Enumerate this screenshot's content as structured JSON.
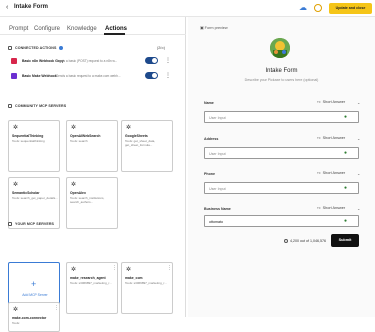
{
  "header": {
    "title": "Intake Form",
    "back_glyph": "‹",
    "update_label": "Update and close",
    "icons": [
      "cloud-sync-icon",
      "history-icon"
    ]
  },
  "tabs": [
    "Prompt",
    "Configure",
    "Knowledge",
    "Actions"
  ],
  "active_tab": "Actions",
  "connected_actions": {
    "heading": "CONNECTED ACTIONS",
    "count": "(2/∞)",
    "items": [
      {
        "name": "Basic n8n Webhook Copy",
        "description": "Sends a basic (POST) request to a n8n w...",
        "enabled": true,
        "icon_color": "#d7264b"
      },
      {
        "name": "Basic Make Webhook",
        "description": "Sends a basic request to a make.com webh...",
        "enabled": true,
        "icon_color": "#6b2fd1"
      }
    ]
  },
  "community_servers": {
    "heading": "COMMUNITY MCP SERVERS",
    "items": [
      {
        "name": "SequentialThinking",
        "tools": "Tools: sequentialthinking"
      },
      {
        "name": "OpenAIWebSearch",
        "tools": "Tools: search"
      },
      {
        "name": "GoogleSheets",
        "tools": "Tools: get_sheet_data, get_sheet_formula..."
      },
      {
        "name": "SemanticScholar",
        "tools": "Tools: search_get_paper_details..."
      },
      {
        "name": "OpenAlex",
        "tools": "Tools: search_institutions, search_authors..."
      }
    ]
  },
  "your_servers": {
    "heading": "YOUR MCP SERVERS",
    "add_label": "Add MCP Server",
    "items": [
      {
        "name": "make_research_agent",
        "tools": "Tools: s3069897_marketing_r..."
      },
      {
        "name": "make_com",
        "tools": "Tools: s3069897_marketing_r..."
      },
      {
        "name": "make-com-connector",
        "tools": "Tools:"
      }
    ]
  },
  "preview": {
    "label": "Form preview",
    "form_title": "Intake Form",
    "form_description": "Describe your Pickaxe to users here (optional)",
    "fields": [
      {
        "label": "Name",
        "type": "Short Answer",
        "placeholder": "User Input",
        "value": ""
      },
      {
        "label": "Address",
        "type": "Short Answer",
        "placeholder": "User Input",
        "value": ""
      },
      {
        "label": "Phone",
        "type": "Short Answer",
        "placeholder": "User Input",
        "value": ""
      },
      {
        "label": "Business Name",
        "type": "Short Answer",
        "placeholder": "User Input",
        "value": "ottomato"
      }
    ],
    "chars_left": "4,200 out of 1,046,576",
    "submit_label": "Submit"
  }
}
